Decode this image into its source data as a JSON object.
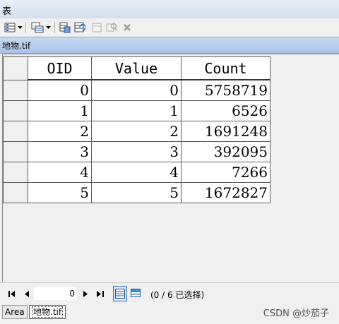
{
  "window": {
    "title": "表"
  },
  "toolbar": {
    "icons": [
      "table-options-icon",
      "dropdown-arrow-icon",
      "related-tables-icon",
      "dropdown-arrow-icon",
      "select-by-attributes-icon",
      "switch-selection-icon",
      "clear-selection-icon",
      "zoom-to-selected-icon",
      "delete-selected-icon"
    ]
  },
  "table_tab": {
    "name": "地物.tif"
  },
  "grid": {
    "columns": [
      "OID",
      "Value",
      "Count"
    ],
    "rows": [
      [
        "0",
        "0",
        "5758719"
      ],
      [
        "1",
        "1",
        "6526"
      ],
      [
        "2",
        "2",
        "1691248"
      ],
      [
        "3",
        "3",
        "392095"
      ],
      [
        "4",
        "4",
        "7266"
      ],
      [
        "5",
        "5",
        "1672827"
      ]
    ]
  },
  "navigation": {
    "current_record": "0",
    "status": "(0 / 6 已选择)"
  },
  "bottom_tabs": [
    "Area",
    "地物.tif"
  ],
  "watermark": "CSDN @炒茄子"
}
